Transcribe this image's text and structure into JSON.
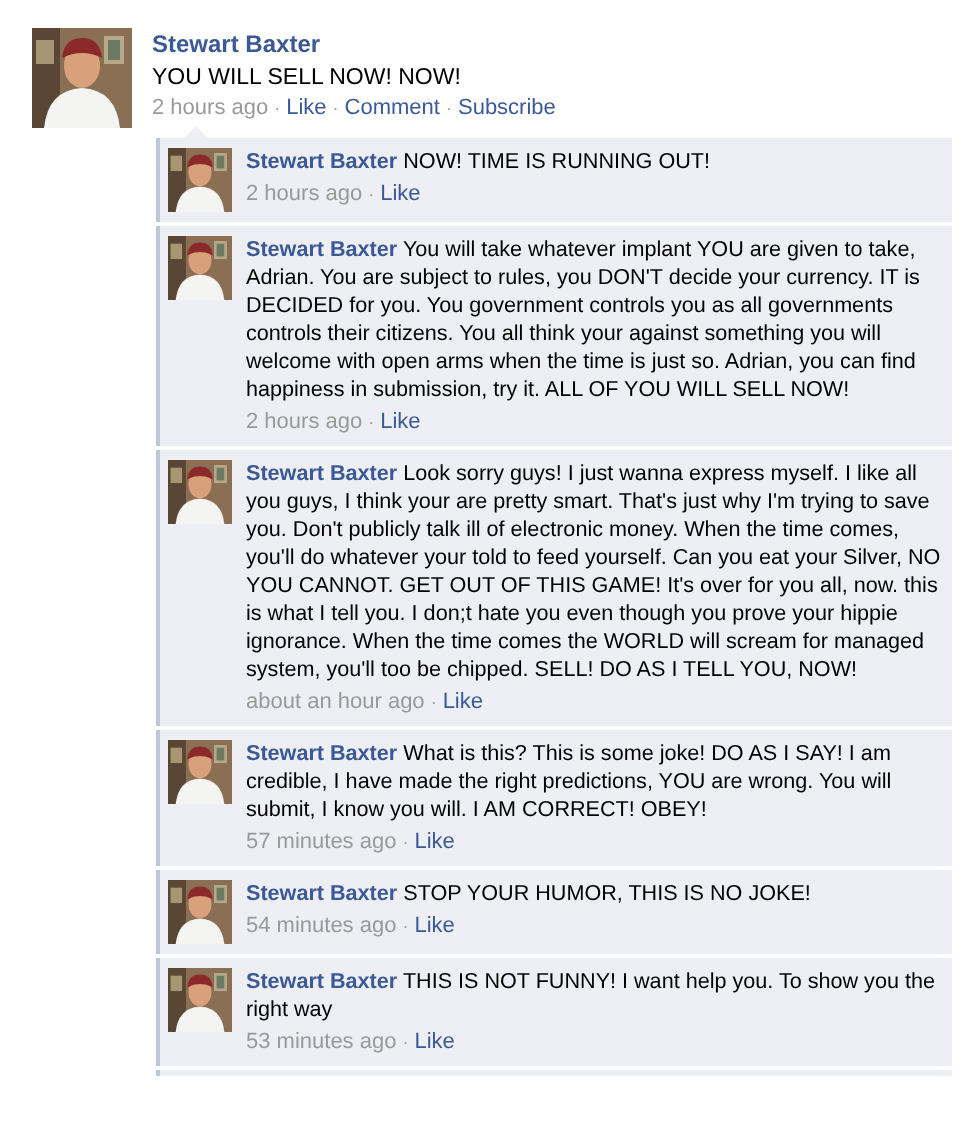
{
  "separator": "·",
  "post": {
    "author": "Stewart Baxter",
    "text": "YOU WILL SELL NOW! NOW!",
    "time": "2 hours ago",
    "actions": [
      "Like",
      "Comment",
      "Subscribe"
    ]
  },
  "comments": [
    {
      "author": "Stewart Baxter",
      "text": "NOW! TIME IS RUNNING OUT!",
      "time": "2 hours ago",
      "actions": [
        "Like"
      ]
    },
    {
      "author": "Stewart Baxter",
      "text": "You will take whatever implant YOU are given to take, Adrian. You are subject to rules, you DON'T decide your currency. IT is DECIDED for you. You government controls you as all governments controls their citizens. You all think your against something you will welcome with open arms when the time is just so. Adrian, you can find happiness in submission, try it. ALL OF YOU WILL SELL NOW!",
      "time": "2 hours ago",
      "actions": [
        "Like"
      ]
    },
    {
      "author": "Stewart Baxter",
      "text": "Look sorry guys! I just wanna express myself. I like all you guys, I think your are pretty smart. That's just why I'm trying to save you. Don't publicly talk ill of electronic money. When the time comes, you'll do whatever your told to feed yourself. Can you eat your Silver, NO YOU CANNOT. GET OUT OF THIS GAME! It's over for you all, now. this is what I tell you. I don;t hate you even though you prove your hippie ignorance. When the time comes the WORLD will scream for managed system, you'll too be chipped. SELL! DO AS I TELL YOU, NOW!",
      "time": "about an hour ago",
      "actions": [
        "Like"
      ]
    },
    {
      "author": "Stewart Baxter",
      "text": "What is this? This is some joke! DO AS I SAY! I am credible, I have made the right predictions, YOU are wrong. You will submit, I know you will. I AM CORRECT! OBEY!",
      "time": "57 minutes ago",
      "actions": [
        "Like"
      ]
    },
    {
      "author": "Stewart Baxter",
      "text": "STOP YOUR HUMOR, THIS IS NO JOKE!",
      "time": "54 minutes ago",
      "actions": [
        "Like"
      ]
    },
    {
      "author": "Stewart Baxter",
      "text": "THIS IS NOT FUNNY! I want help you. To show you the right way",
      "time": "53 minutes ago",
      "actions": [
        "Like"
      ]
    }
  ]
}
